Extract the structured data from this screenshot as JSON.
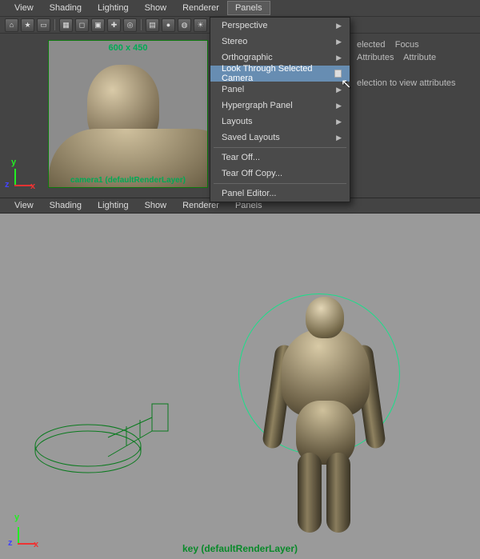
{
  "panel1": {
    "menus": [
      "View",
      "Shading",
      "Lighting",
      "Show",
      "Renderer",
      "Panels"
    ],
    "open_menu_index": 5,
    "render_dim": "600 x 450",
    "camera_label": "camera1 (defaultRenderLayer)"
  },
  "right": {
    "line1a": "elected",
    "line1b": "Focus",
    "line1c": "Attributes",
    "line1d": "Attribute",
    "line2": "election to view attributes"
  },
  "panels_menu": {
    "items": [
      {
        "label": "Perspective",
        "submenu": true
      },
      {
        "label": "Stereo",
        "submenu": true
      },
      {
        "label": "Orthographic",
        "submenu": true
      },
      {
        "label": "Look Through Selected Camera",
        "checkbox": true,
        "selected": true
      },
      {
        "label": "Panel",
        "submenu": true
      },
      {
        "label": "Hypergraph Panel",
        "submenu": true
      },
      {
        "label": "Layouts",
        "submenu": true
      },
      {
        "label": "Saved Layouts",
        "submenu": true,
        "sep_after": true
      },
      {
        "label": "Tear Off..."
      },
      {
        "label": "Tear Off Copy...",
        "sep_after": true
      },
      {
        "label": "Panel Editor..."
      }
    ]
  },
  "panel2": {
    "menus": [
      "View",
      "Shading",
      "Lighting",
      "Show",
      "Renderer",
      "Panels"
    ],
    "label": "key (defaultRenderLayer)"
  },
  "axis": {
    "x": "x",
    "y": "y",
    "z": "z"
  },
  "toolbar_icons": [
    "select-camera-icon",
    "bookmark-icon",
    "image-plane-icon",
    "grid-icon",
    "film-gate-icon",
    "resolution-gate-icon",
    "field-chart-icon",
    "safe-action-icon",
    "wireframe-icon",
    "shaded-icon",
    "textured-icon",
    "lights-icon",
    "shadows-icon",
    "xray-icon",
    "isolate-icon",
    "high-quality-icon",
    "renderer-icon"
  ]
}
